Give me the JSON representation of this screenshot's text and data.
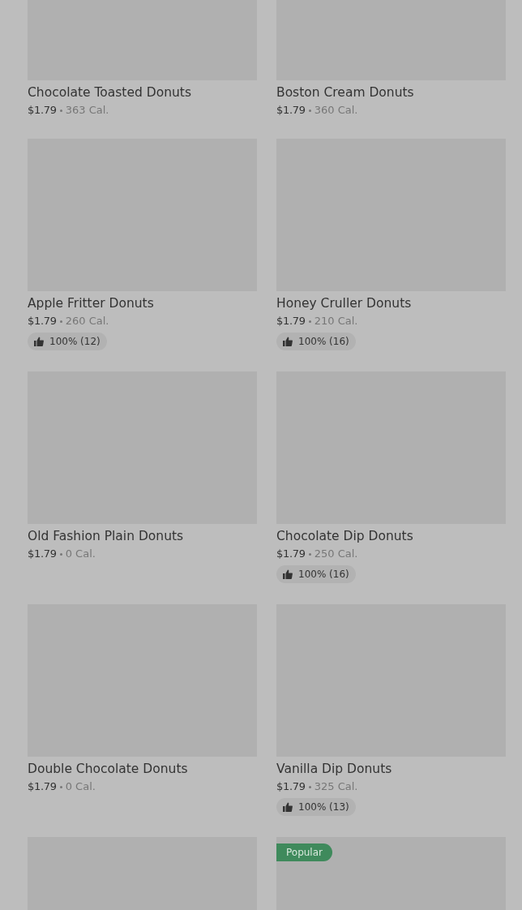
{
  "items": [
    {
      "kind": "card",
      "name": "Chocolate Toasted Donuts",
      "price": "$1.79",
      "calories": "363 Cal."
    },
    {
      "kind": "card",
      "name": "Boston Cream Donuts",
      "price": "$1.79",
      "calories": "360 Cal."
    },
    {
      "kind": "card",
      "name": "Apple Fritter Donuts",
      "price": "$1.79",
      "calories": "260 Cal.",
      "rating": "100% (12)"
    },
    {
      "kind": "card",
      "name": "Honey Cruller Donuts",
      "price": "$1.79",
      "calories": "210 Cal.",
      "rating": "100% (16)"
    },
    {
      "kind": "card",
      "name": "Old Fashion Plain Donuts",
      "price": "$1.79",
      "calories": "0 Cal."
    },
    {
      "kind": "card",
      "name": "Chocolate Dip Donuts",
      "price": "$1.79",
      "calories": "250 Cal.",
      "rating": "100% (16)"
    },
    {
      "kind": "card",
      "name": "Double Chocolate Donuts",
      "price": "$1.79",
      "calories": "0 Cal."
    },
    {
      "kind": "card",
      "name": "Vanilla Dip Donuts",
      "price": "$1.79",
      "calories": "325 Cal.",
      "rating": "100% (13)"
    },
    {
      "kind": "image_only"
    },
    {
      "kind": "image_only",
      "tag": "Popular"
    }
  ]
}
